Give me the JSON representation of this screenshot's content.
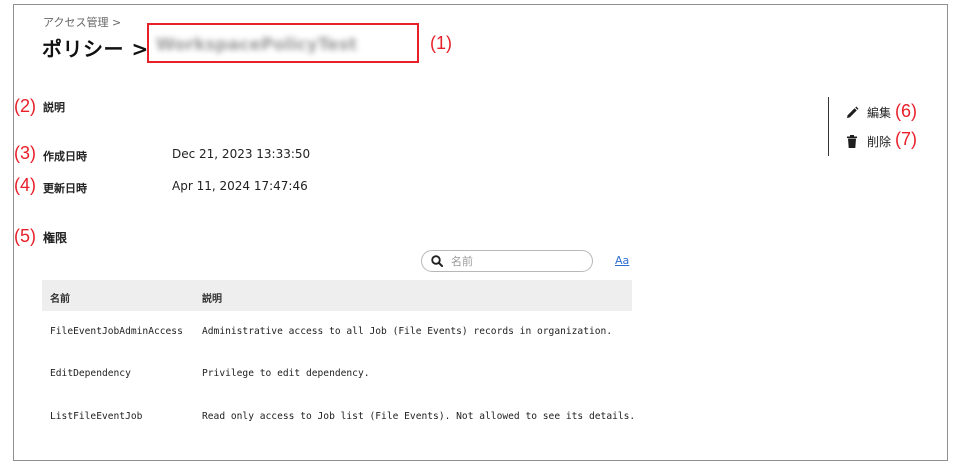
{
  "breadcrumb": "アクセス管理 >",
  "title": "ポリシー >",
  "policy_name": "WorkspacePolicyTest",
  "callouts": [
    "(1)",
    "(2)",
    "(3)",
    "(4)",
    "(5)",
    "(6)",
    "(7)"
  ],
  "fields": {
    "description_label": "説明",
    "created_label": "作成日時",
    "created_value": "Dec 21, 2023 13:33:50",
    "updated_label": "更新日時",
    "updated_value": "Apr 11, 2024 17:47:46"
  },
  "permissions_title": "権限",
  "actions": {
    "edit": "編集",
    "delete": "削除"
  },
  "search": {
    "placeholder": "名前"
  },
  "case_toggle": "Aa",
  "table": {
    "headers": [
      "名前",
      "説明"
    ],
    "rows": [
      {
        "name": "FileEventJobAdminAccess",
        "description": "Administrative access to all Job (File Events) records in organization."
      },
      {
        "name": "EditDependency",
        "description": "Privilege to edit dependency."
      },
      {
        "name": "ListFileEventJob",
        "description": "Read only access to Job list (File Events). Not allowed to see its details."
      }
    ]
  },
  "colors": {
    "annotation": "#e8202a",
    "link": "#2d6fd0"
  }
}
